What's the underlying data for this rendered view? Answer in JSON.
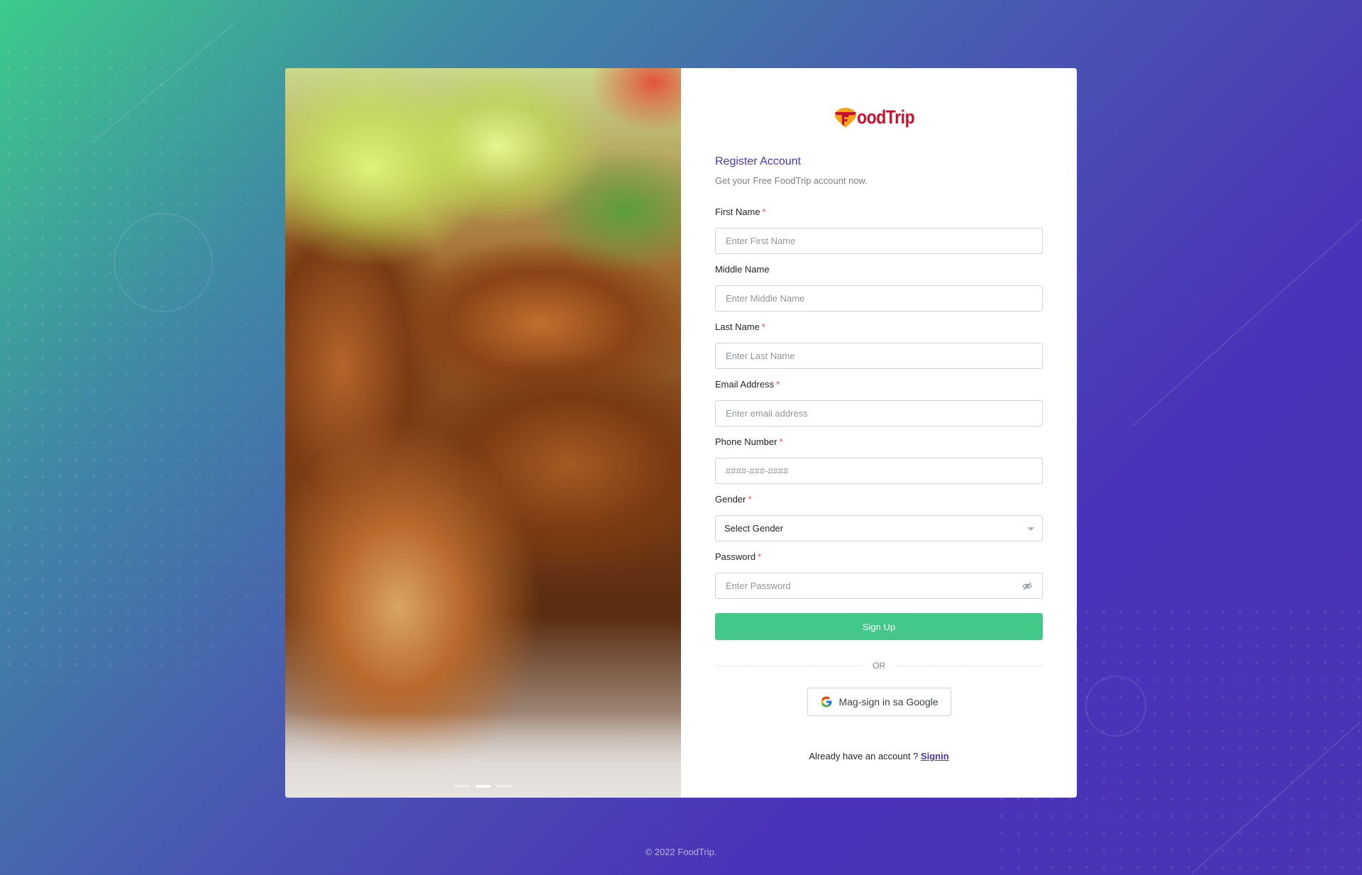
{
  "brand": {
    "name": "FoodTrip",
    "logo_text": "oodTrip",
    "accent": "#4a35b4",
    "primary_button": "#42c98a",
    "logo_red": "#c8102e"
  },
  "carousel": {
    "slide_count": 3,
    "active_index": 1
  },
  "form": {
    "title": "Register Account",
    "subtitle": "Get your Free FoodTrip account now.",
    "required_mark": "*",
    "fields": {
      "first_name": {
        "label": "First Name",
        "placeholder": "Enter First Name",
        "required": true
      },
      "middle_name": {
        "label": "Middle Name",
        "placeholder": "Enter Middle Name",
        "required": false
      },
      "last_name": {
        "label": "Last Name",
        "placeholder": "Enter Last Name",
        "required": true
      },
      "email": {
        "label": "Email Address",
        "placeholder": "Enter email address",
        "required": true
      },
      "phone": {
        "label": "Phone Number",
        "placeholder": "####-###-####",
        "required": true
      },
      "gender": {
        "label": "Gender",
        "value": "Select Gender",
        "required": true
      },
      "password": {
        "label": "Password",
        "placeholder": "Enter Password",
        "required": true,
        "toggle_icon": "eye-slash-icon"
      }
    },
    "signup_label": "Sign Up",
    "or_label": "OR",
    "google_label": "Mag-sign in sa Google",
    "signin_prompt": "Already have an account ? ",
    "signin_link": "Signin"
  },
  "footer": {
    "copyright": "© 2022 FoodTrip."
  }
}
